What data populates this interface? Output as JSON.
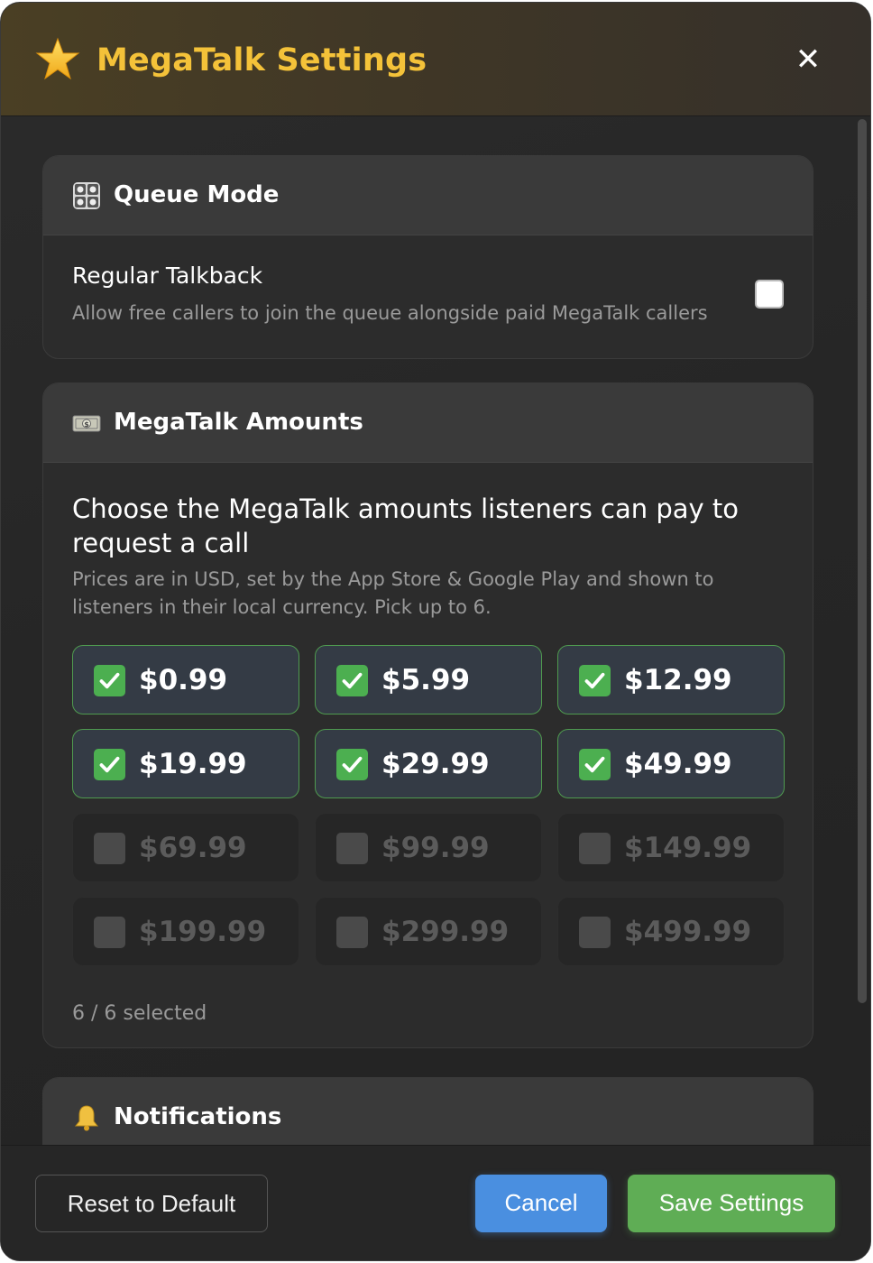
{
  "dialog": {
    "title": "MegaTalk Settings",
    "close_label": "✕",
    "accent_color": "#f4c239"
  },
  "queue_mode": {
    "title": "Queue Mode",
    "icon": "control-knobs-icon",
    "option": {
      "label": "Regular Talkback",
      "description": "Allow free callers to join the queue alongside paid MegaTalk callers",
      "checked": false
    }
  },
  "amounts": {
    "title": "MegaTalk Amounts",
    "icon": "dollar-banknote-icon",
    "intro": "Choose the MegaTalk amounts listeners can pay to request a call",
    "note": "Prices are in USD, set by the App Store & Google Play and shown to listeners in their local currency. Pick up to 6.",
    "options": [
      {
        "price": "$0.99",
        "checked": true
      },
      {
        "price": "$5.99",
        "checked": true
      },
      {
        "price": "$12.99",
        "checked": true
      },
      {
        "price": "$19.99",
        "checked": true
      },
      {
        "price": "$29.99",
        "checked": true
      },
      {
        "price": "$49.99",
        "checked": true
      },
      {
        "price": "$69.99",
        "checked": false
      },
      {
        "price": "$99.99",
        "checked": false
      },
      {
        "price": "$149.99",
        "checked": false
      },
      {
        "price": "$199.99",
        "checked": false
      },
      {
        "price": "$299.99",
        "checked": false
      },
      {
        "price": "$499.99",
        "checked": false
      }
    ],
    "selected_count": "6 / 6 selected",
    "checked_color": "#4caf50"
  },
  "notifications": {
    "title": "Notifications",
    "icon": "bell-icon"
  },
  "footer": {
    "reset_label": "Reset to Default",
    "cancel_label": "Cancel",
    "save_label": "Save Settings",
    "cancel_color": "#4a8fe0",
    "save_color": "#5fad55"
  }
}
